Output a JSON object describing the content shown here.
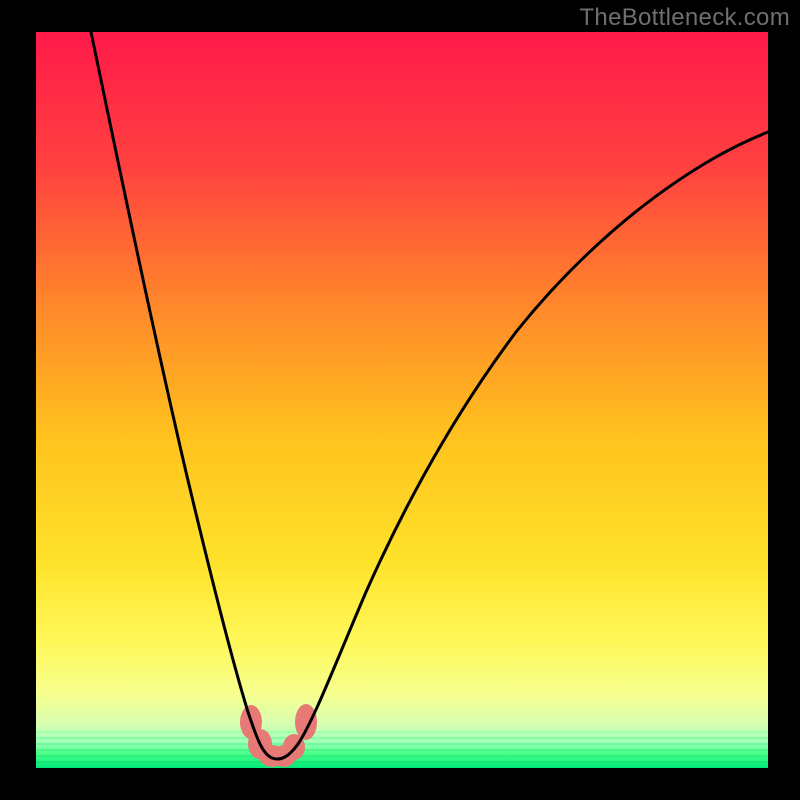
{
  "watermark": "TheBottleneck.com",
  "chart_data": {
    "type": "line",
    "title": "",
    "xlabel": "",
    "ylabel": "",
    "xlim": [
      0,
      100
    ],
    "ylim": [
      0,
      100
    ],
    "grid": false,
    "legend": false,
    "background_gradient": {
      "top": "#ff1a4a",
      "mid_upper": "#ff7a2a",
      "mid": "#ffd400",
      "mid_lower": "#f8ff6a",
      "green_band": "#3dff6e",
      "bottom": "#00e87a"
    },
    "series": [
      {
        "name": "bottleneck-curve",
        "color": "#000000",
        "x": [
          7.5,
          10,
          13,
          16,
          19,
          22,
          25,
          27,
          29,
          30.5,
          32,
          33.5,
          35,
          36.5,
          38,
          40,
          43,
          47,
          52,
          58,
          65,
          73,
          82,
          92,
          100
        ],
        "y": [
          100,
          89,
          76,
          63,
          50,
          37,
          24,
          15,
          8,
          4,
          2,
          1.5,
          2,
          4,
          8,
          15,
          25,
          37,
          49,
          59,
          67,
          74,
          79,
          83,
          85.5
        ]
      }
    ],
    "marker_groups": [
      {
        "name": "low-points-cluster",
        "color": "#e77a75",
        "shape": "rounded-blob",
        "points": [
          {
            "x": 29.5,
            "y": 6.0
          },
          {
            "x": 30.5,
            "y": 3.2
          },
          {
            "x": 32.0,
            "y": 1.5
          },
          {
            "x": 33.3,
            "y": 1.5
          },
          {
            "x": 34.5,
            "y": 2.5
          },
          {
            "x": 36.5,
            "y": 6.0
          }
        ]
      }
    ]
  }
}
